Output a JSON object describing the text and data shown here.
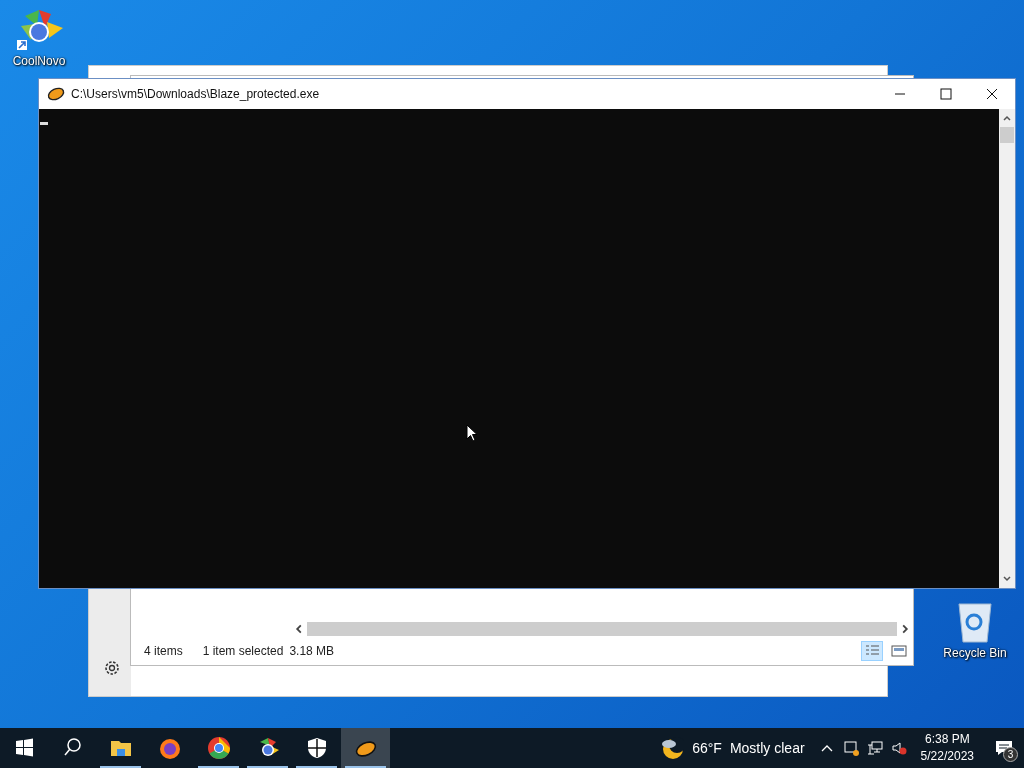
{
  "desktop_icons": [
    {
      "label": "CoolNovo",
      "kind": "browser"
    },
    {
      "label": "Recycle Bin",
      "kind": "bin"
    }
  ],
  "explorer": {
    "item_count": "4 items",
    "selection": "1 item selected",
    "size": "3.18 MB"
  },
  "console": {
    "title": "C:\\Users\\vm5\\Downloads\\Blaze_protected.exe"
  },
  "taskbar": {
    "apps": [
      {
        "kind": "explorer",
        "running": true,
        "selected": false
      },
      {
        "kind": "firefox",
        "running": false,
        "selected": false
      },
      {
        "kind": "chrome",
        "running": true,
        "selected": false
      },
      {
        "kind": "coolnovo",
        "running": true,
        "selected": false
      },
      {
        "kind": "shield",
        "running": true,
        "selected": false
      },
      {
        "kind": "blaze",
        "running": true,
        "selected": true
      }
    ],
    "temperature": "66°F",
    "weather": "Mostly clear",
    "time": "6:38 PM",
    "date": "5/22/2023",
    "notification_count": "3"
  }
}
